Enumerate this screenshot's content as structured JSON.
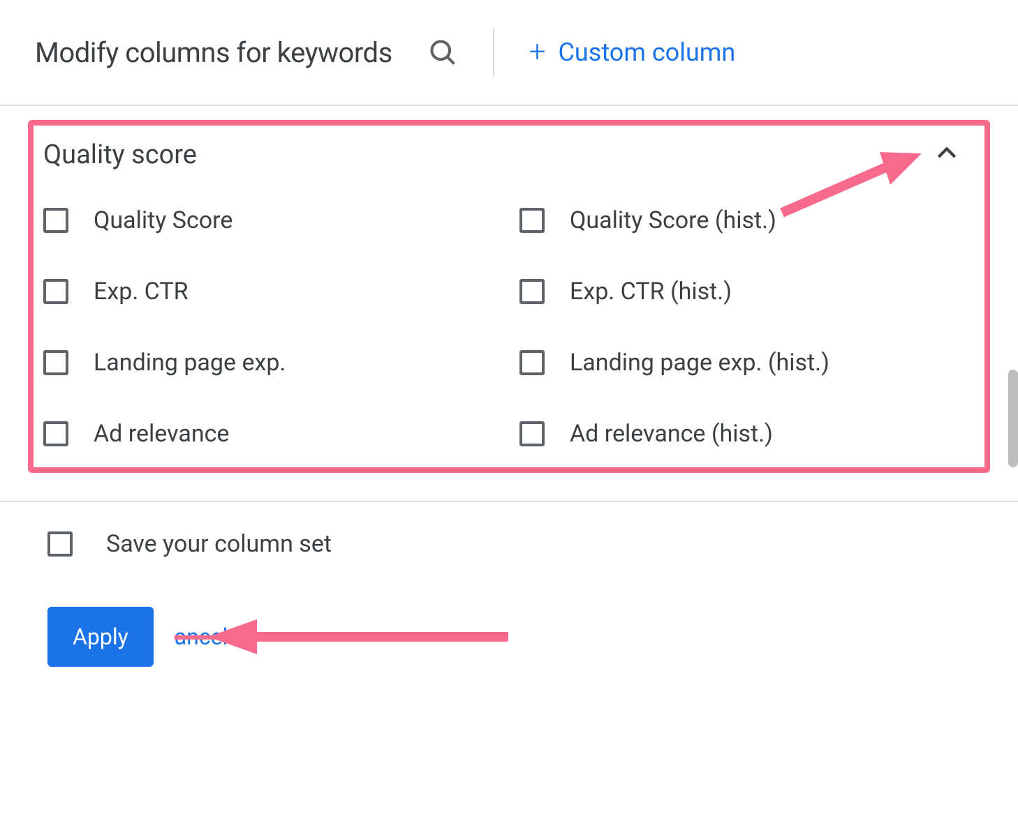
{
  "header": {
    "title": "Modify columns for keywords",
    "custom_column_label": "Custom column"
  },
  "section": {
    "title": "Quality score",
    "options_left": [
      "Quality Score",
      "Exp. CTR",
      "Landing page exp.",
      "Ad relevance"
    ],
    "options_right": [
      "Quality Score (hist.)",
      "Exp. CTR (hist.)",
      "Landing page exp. (hist.)",
      "Ad relevance (hist.)"
    ]
  },
  "footer": {
    "save_label": "Save your column set",
    "apply_label": "Apply",
    "cancel_label": "ancel"
  },
  "colors": {
    "accent": "#1a73e8",
    "highlight": "#f76a8c"
  }
}
